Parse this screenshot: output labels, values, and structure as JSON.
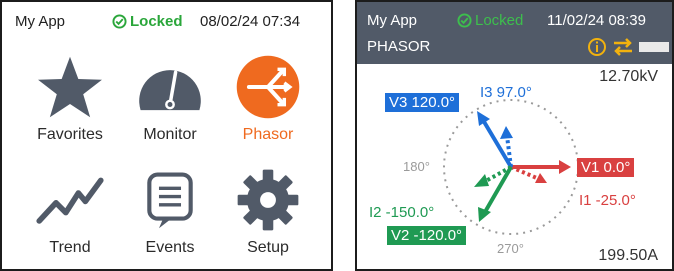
{
  "home": {
    "app_name": "My App",
    "lock_status": "Locked",
    "datetime": "08/02/24 07:34",
    "tiles": [
      {
        "label": "Favorites",
        "icon": "star-icon"
      },
      {
        "label": "Monitor",
        "icon": "gauge-icon"
      },
      {
        "label": "Phasor",
        "icon": "phasor-icon",
        "active": true
      },
      {
        "label": "Trend",
        "icon": "trend-icon"
      },
      {
        "label": "Events",
        "icon": "events-icon"
      },
      {
        "label": "Setup",
        "icon": "gear-icon"
      }
    ]
  },
  "phasor": {
    "app_name": "My App",
    "lock_status": "Locked",
    "datetime": "11/02/24 08:39",
    "title": "PHASOR",
    "voltage_scale": "12.70kV",
    "current_scale": "199.50A",
    "angle_180": "180°",
    "angle_270": "270°",
    "v1": "V1 0.0°",
    "v2": "V2 -120.0°",
    "v3": "V3 120.0°",
    "i1": "I1 -25.0°",
    "i2": "I2 -150.0°",
    "i3": "I3 97.0°",
    "colors": {
      "v1": "#d94040",
      "v2": "#1f9a53",
      "v3": "#1e6fd8",
      "accent": "#ef6a1f",
      "header": "#515a68",
      "warn": "#f2b20e"
    }
  }
}
